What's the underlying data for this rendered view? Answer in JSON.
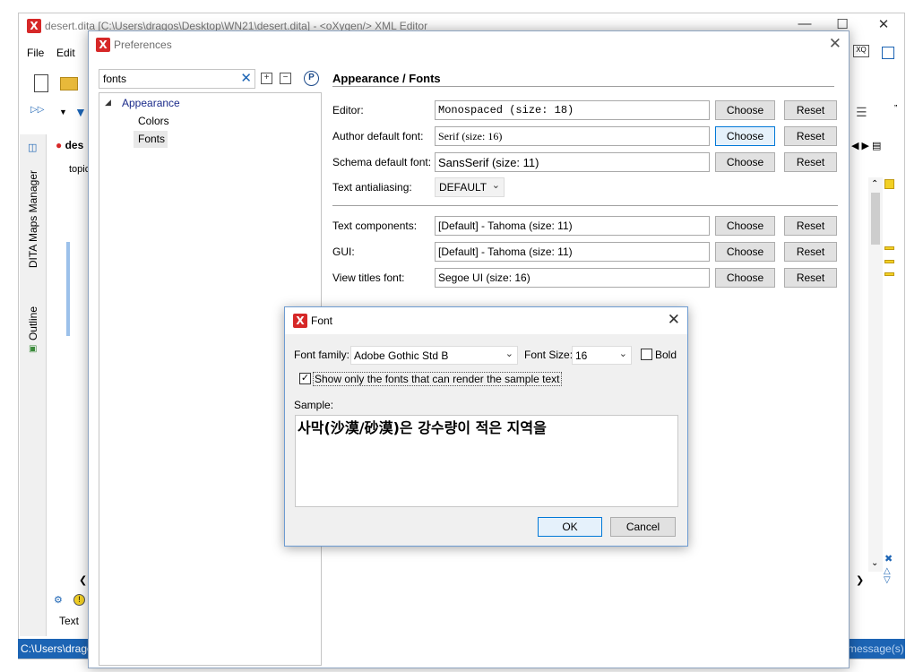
{
  "main_window": {
    "title": "desert.dita [C:\\Users\\dragos\\Desktop\\WN21\\desert.dita] - <oXygen/> XML Editor",
    "menu": [
      "File",
      "Edit"
    ],
    "editor_tab": "des",
    "breadcrumb": "topic",
    "vertical_tabs": [
      "DITA Maps Manager",
      "Outline"
    ],
    "bottom_tab": "Text",
    "status_left": "C:\\Users\\drago",
    "status_right": "message(s)"
  },
  "preferences": {
    "title": "Preferences",
    "filter_value": "fonts",
    "tree": {
      "root": "Appearance",
      "children": [
        "Colors",
        "Fonts"
      ],
      "selected": "Fonts"
    },
    "page_title": "Appearance / Fonts",
    "rows_top": [
      {
        "label": "Editor:",
        "value": "Monospaced (size: 18)",
        "choose": "Choose",
        "reset": "Reset"
      },
      {
        "label": "Author default font:",
        "value": "Serif (size: 16)",
        "choose": "Choose",
        "reset": "Reset"
      },
      {
        "label": "Schema default font:",
        "value": "SansSerif (size: 11)",
        "choose": "Choose",
        "reset": "Reset"
      }
    ],
    "antialiasing": {
      "label": "Text antialiasing:",
      "value": "DEFAULT"
    },
    "rows_bottom": [
      {
        "label": "Text components:",
        "value": "[Default] - Tahoma (size: 11)",
        "choose": "Choose",
        "reset": "Reset"
      },
      {
        "label": "GUI:",
        "value": "[Default] - Tahoma (size: 11)",
        "choose": "Choose",
        "reset": "Reset"
      },
      {
        "label": "View titles font:",
        "value": "Segoe UI (size: 16)",
        "choose": "Choose",
        "reset": "Reset"
      }
    ]
  },
  "font_dialog": {
    "title": "Font",
    "family_label": "Font family:",
    "family_value": "Adobe Gothic Std B",
    "size_label": "Font Size:",
    "size_value": "16",
    "bold_label": "Bold",
    "bold_checked": false,
    "show_only_label": "Show only the fonts that can render the sample text",
    "show_only_checked": true,
    "sample_label": "Sample:",
    "sample_text": "사막(沙漠/砂漠)은 강수량이 적은 지역을",
    "ok": "OK",
    "cancel": "Cancel"
  },
  "colors": {
    "accent": "#1c64b4",
    "logo": "#d62828",
    "focus": "#0078d7"
  }
}
